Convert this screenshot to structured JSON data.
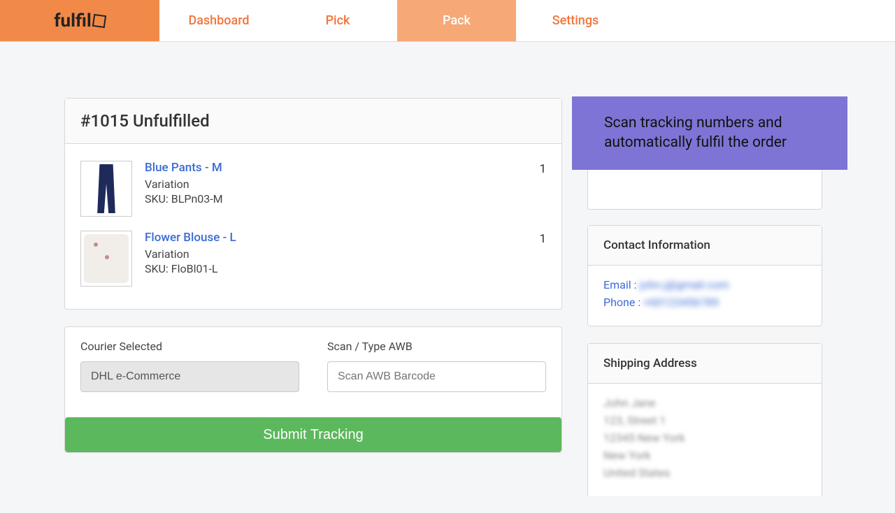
{
  "brand": "fulfil",
  "nav": {
    "items": [
      {
        "label": "Dashboard",
        "active": false
      },
      {
        "label": "Pick",
        "active": false
      },
      {
        "label": "Pack",
        "active": true
      },
      {
        "label": "Settings",
        "active": false
      }
    ]
  },
  "order": {
    "header": "#1015 Unfulfilled",
    "items": [
      {
        "name": "Blue Pants - M",
        "variation": "Variation",
        "sku_label": "SKU: BLPn03-M",
        "qty": "1"
      },
      {
        "name": "Flower Blouse - L",
        "variation": "Variation",
        "sku_label": "SKU: FloBl01-L",
        "qty": "1"
      }
    ]
  },
  "courier_form": {
    "courier_label": "Courier Selected",
    "courier_value": "DHL e-Commerce",
    "awb_label": "Scan / Type AWB",
    "awb_placeholder": "Scan AWB Barcode",
    "submit_label": "Submit Tracking"
  },
  "callout_text": "Scan tracking numbers and automatically fulfil the order",
  "contact": {
    "title": "Contact Information",
    "email_label": "Email :",
    "email_value": "john.j@gmail.com",
    "phone_label": "Phone :",
    "phone_value": "+60123456789"
  },
  "shipping": {
    "title": "Shipping Address",
    "lines": [
      "John Jane",
      "123, Street 1",
      "12345 New York",
      "New York",
      "United States"
    ]
  }
}
